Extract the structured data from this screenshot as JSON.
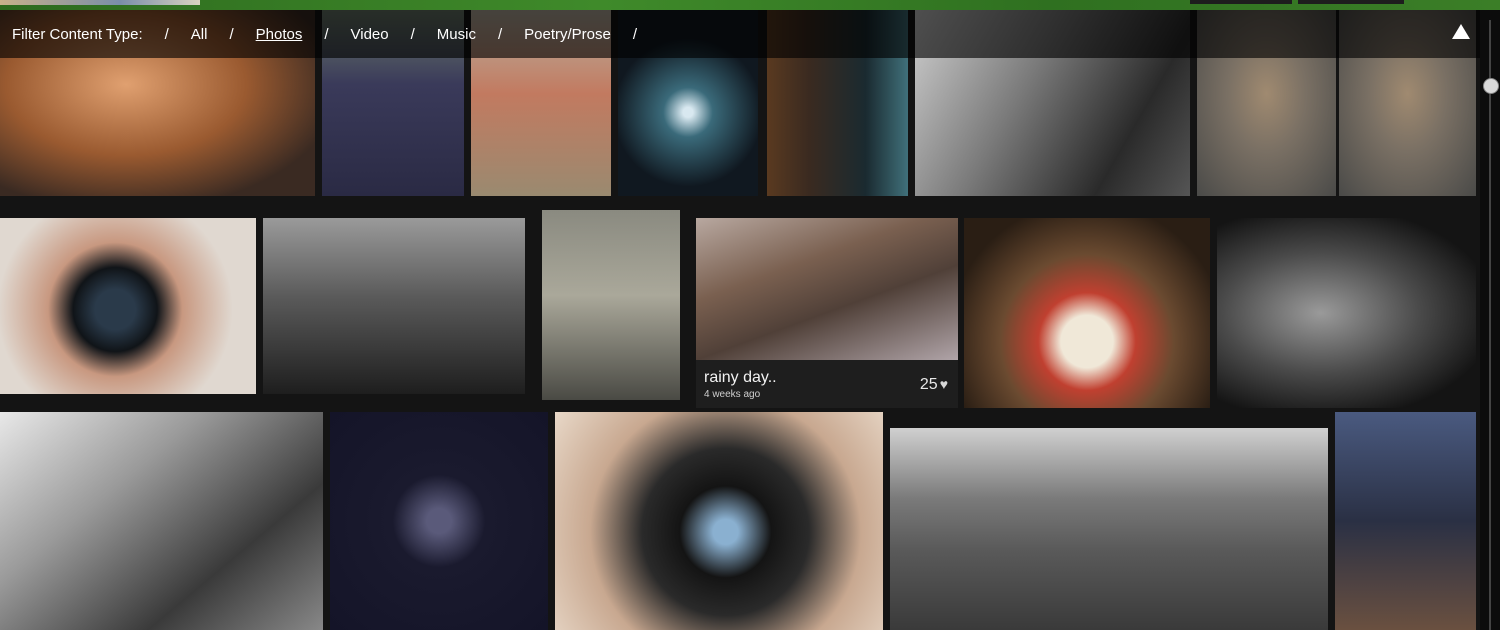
{
  "filter": {
    "label": "Filter Content Type:",
    "separator": "/",
    "options": [
      "All",
      "Photos",
      "Video",
      "Music",
      "Poetry/Prose"
    ],
    "active": "Photos"
  },
  "featured_photo": {
    "title": "rainy day..",
    "time": "4 weeks ago",
    "likes": "25",
    "like_icon": "heart-icon"
  },
  "colors": {
    "accent_green": "#3f8a2a",
    "bar_bg": "#1e1e1e"
  }
}
